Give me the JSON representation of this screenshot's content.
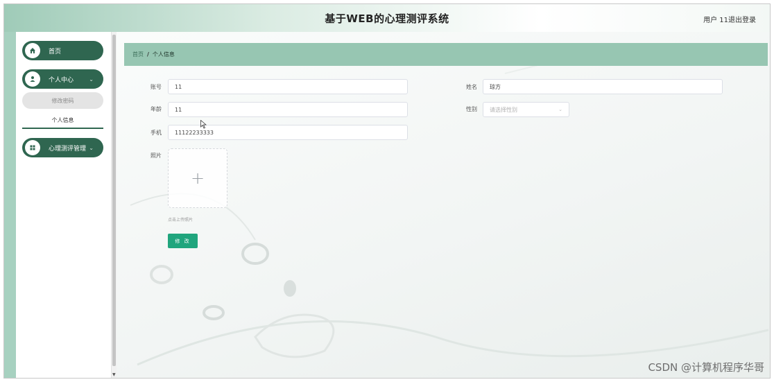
{
  "header": {
    "title": "基于WEB的心理测评系统",
    "user_label": "用户 11",
    "logout_label": "退出登录"
  },
  "sidebar": {
    "home": {
      "label": "首页",
      "icon": "home-icon"
    },
    "personal_center": {
      "label": "个人中心",
      "icon": "user-icon",
      "chevron": "⌄"
    },
    "sub_items": [
      {
        "label": "修改密码"
      },
      {
        "label": "个人信息"
      }
    ],
    "assessment": {
      "label": "心理测评管理",
      "icon": "grid-icon",
      "chevron": "⌄"
    }
  },
  "breadcrumb": {
    "home": "首页",
    "separator": "/",
    "current": "个人信息"
  },
  "form": {
    "account": {
      "label": "账号",
      "value": "11"
    },
    "name": {
      "label": "姓名",
      "value": "琼方"
    },
    "age": {
      "label": "年龄",
      "value": "11"
    },
    "gender": {
      "label": "性别",
      "placeholder": "请选择性别"
    },
    "phone": {
      "label": "手机",
      "value": "11122233333"
    },
    "photo": {
      "label": "照片",
      "upload_tip": "点击上传照片"
    },
    "submit_label": "修 改"
  },
  "watermark": "CSDN @计算机程序华哥",
  "colors": {
    "primary_dark": "#2f6650",
    "breadcrumb_bg": "#97c6b2",
    "button": "#20a57d"
  }
}
